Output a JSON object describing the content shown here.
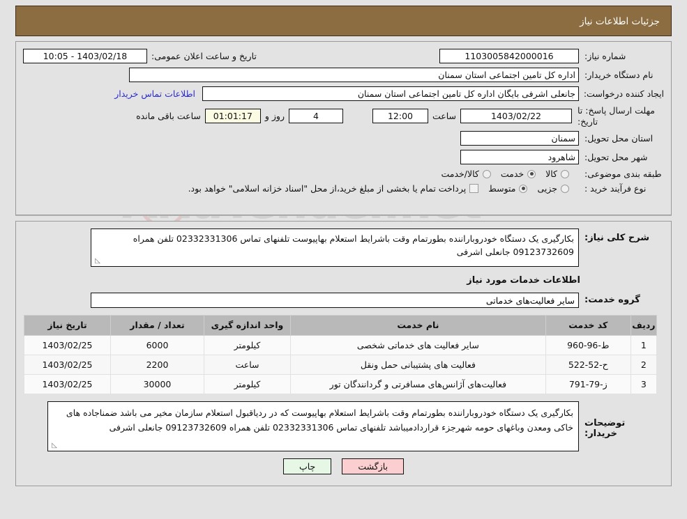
{
  "header": {
    "title": "جزئیات اطلاعات نیاز"
  },
  "top_form": {
    "need_number_label": "شماره نیاز:",
    "need_number_value": "1103005842000016",
    "announce_datetime_label": "تاریخ و ساعت اعلان عمومی:",
    "announce_datetime_value": "1403/02/18 - 10:05",
    "buyer_org_label": "نام دستگاه خریدار:",
    "buyer_org_value": "اداره کل تامین اجتماعی استان سمنان",
    "requester_label": "ایجاد کننده درخواست:",
    "requester_value": "جانعلی  اشرفی  بایگان  اداره کل تامین اجتماعی استان سمنان",
    "contact_link": "اطلاعات تماس خریدار",
    "deadline_label": "مهلت ارسال پاسخ: تا تاریخ:",
    "deadline_date": "1403/02/22",
    "hour_label": "ساعت",
    "deadline_time": "12:00",
    "days_remaining": "4",
    "days_label": "روز و",
    "time_remaining": "01:01:17",
    "remaining_suffix": "ساعت باقی مانده",
    "province_label": "استان محل تحویل:",
    "province_value": "سمنان",
    "city_label": "شهر محل تحویل:",
    "city_value": "شاهرود",
    "category_label": "طبقه بندی موضوعی:",
    "category_options": [
      {
        "label": "کالا",
        "selected": false
      },
      {
        "label": "خدمت",
        "selected": true
      },
      {
        "label": "کالا/خدمت",
        "selected": false
      }
    ],
    "process_label": "نوع فرآیند خرید :",
    "process_options": [
      {
        "label": "جزیی",
        "selected": false
      },
      {
        "label": "متوسط",
        "selected": true
      }
    ],
    "treasury_checkbox_label": "پرداخت تمام یا بخشی از مبلغ خرید،از محل \"اسناد خزانه اسلامی\" خواهد بود.",
    "treasury_checked": false
  },
  "description": {
    "summary_label": "شرح کلی نیاز:",
    "summary_value": "بکارگیری یک دستگاه خودروباراننده بطورتمام وقت باشرایط استعلام بهاپیوست تلفنهای تماس 02332331306 تلفن همراه 09123732609 جانعلی اشرفی",
    "section_title": "اطلاعات خدمات مورد نیاز",
    "service_group_label": "گروه خدمت:",
    "service_group_value": "سایر فعالیت‌های خدماتی"
  },
  "table": {
    "columns": [
      "ردیف",
      "کد خدمت",
      "نام خدمت",
      "واحد اندازه گیری",
      "تعداد / مقدار",
      "تاریخ نیاز"
    ],
    "rows": [
      {
        "radif": "1",
        "code": "ط-96-960",
        "name": "سایر فعالیت های خدماتی شخصی",
        "unit": "کیلومتر",
        "qty": "6000",
        "date": "1403/02/25"
      },
      {
        "radif": "2",
        "code": "ح-52-522",
        "name": "فعالیت های پشتیبانی حمل ونقل",
        "unit": "ساعت",
        "qty": "2200",
        "date": "1403/02/25"
      },
      {
        "radif": "3",
        "code": "ز-79-791",
        "name": "فعالیت‌های آژانس‌های مسافرتی و گردانندگان تور",
        "unit": "کیلومتر",
        "qty": "30000",
        "date": "1403/02/25"
      }
    ]
  },
  "buyer_notes": {
    "label": "توضیحات خریدار:",
    "value": "بکارگیری یک دستگاه خودروباراننده بطورتمام وقت باشرایط استعلام بهاپیوست که در ردیاقبول استعلام سازمان مخیر می باشد ضمناجاده های خاکی ومعدن وباغهای حومه شهرجزء قراردادمیباشد تلفنهای تماس 02332331306 تلفن همراه 09123732609 جانعلی اشرفی"
  },
  "footer": {
    "back_label": "بازگشت",
    "print_label": "چاپ"
  },
  "watermark": {
    "text": "AriaTender.net"
  },
  "colors": {
    "header_brown": "#8c6d41",
    "page_bg": "#e3e3e3",
    "link_blue": "#2b2bcf",
    "timer_bg": "#fbfbe3",
    "back_btn": "#fbcfcf",
    "print_btn": "#e6f7e6",
    "table_header": "#b9b9b9"
  }
}
